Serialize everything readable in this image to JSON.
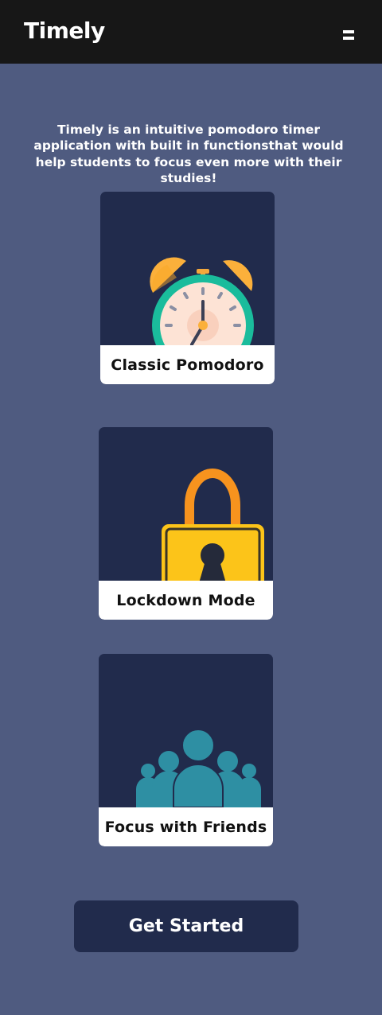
{
  "header": {
    "title": "Timely",
    "menu_icon": "hamburger-menu-icon"
  },
  "intro": {
    "text": "Timely is an intuitive pomodoro timer application with built in functionsthat would help students to focus even more with their studies!"
  },
  "features": [
    {
      "label": "Classic Pomodoro",
      "icon": "alarm-clock-icon"
    },
    {
      "label": "Lockdown Mode",
      "icon": "padlock-icon"
    },
    {
      "label": "Focus with Friends",
      "icon": "group-people-icon"
    }
  ],
  "cta": {
    "label": "Get Started"
  },
  "colors": {
    "background": "#4f5b80",
    "header": "#171717",
    "card": "#212b4c",
    "clock_ring": "#1abc9c",
    "clock_bells": "#fbb03b",
    "lock_body": "#fcc419",
    "lock_shackle": "#f7931e",
    "people": "#2e8fa3"
  }
}
